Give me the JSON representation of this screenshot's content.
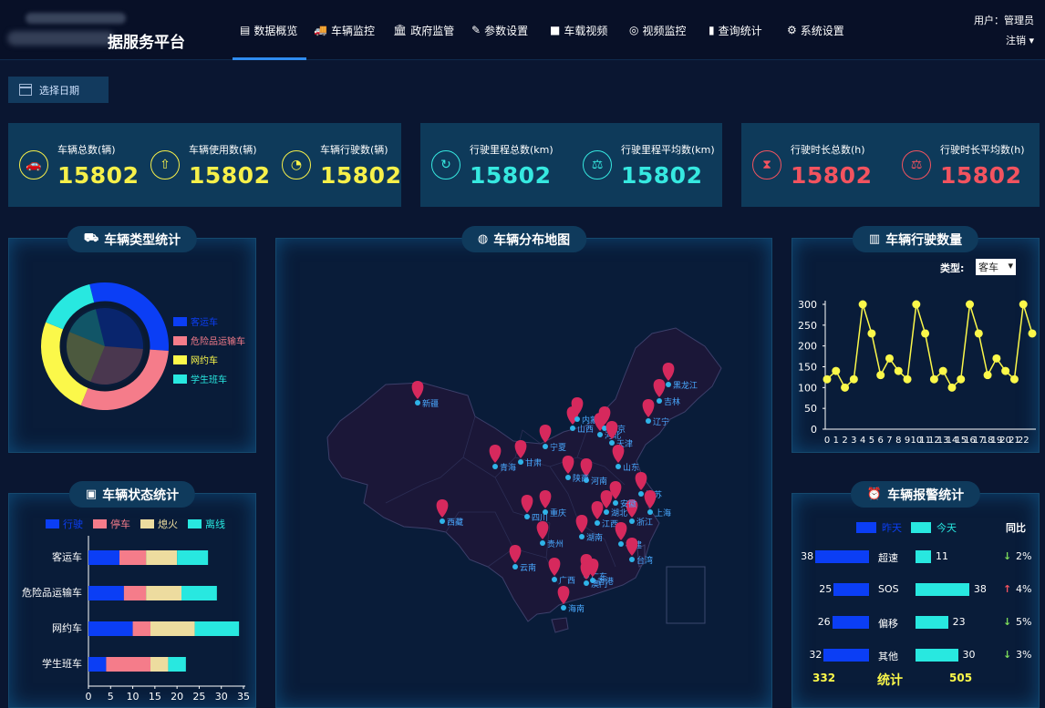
{
  "header": {
    "title": "据服务平台",
    "nav": [
      {
        "icon": "document-icon",
        "glyph": "▤",
        "label": "数据概览",
        "active": true
      },
      {
        "icon": "truck-icon",
        "glyph": "🚚",
        "label": "车辆监控"
      },
      {
        "icon": "bank-icon",
        "glyph": "🏛",
        "label": "政府监管"
      },
      {
        "icon": "edit-icon",
        "glyph": "✎",
        "label": "参数设置"
      },
      {
        "icon": "video-camera-icon",
        "glyph": "■",
        "label": "车载视频"
      },
      {
        "icon": "webcam-icon",
        "glyph": "◎",
        "label": "视频监控"
      },
      {
        "icon": "bar-chart-icon",
        "glyph": "▮",
        "label": "查询统计"
      },
      {
        "icon": "gear-icon",
        "glyph": "⚙",
        "label": "系统设置"
      }
    ],
    "user_label": "用户：管理员",
    "logout_label": "注销"
  },
  "date_picker": {
    "label": "选择日期"
  },
  "stats": [
    {
      "icon": "car-icon",
      "glyph": "🚗",
      "label": "车辆总数(辆)",
      "value": "15802",
      "color": "#f6f04a"
    },
    {
      "icon": "upload-icon",
      "glyph": "⇧",
      "label": "车辆使用数(辆)",
      "value": "15802",
      "color": "#f6f04a"
    },
    {
      "icon": "pie-icon",
      "glyph": "◔",
      "label": "车辆行驶数(辆)",
      "value": "15802",
      "color": "#f6f04a"
    },
    {
      "icon": "speed-icon",
      "glyph": "↻",
      "label": "行驶里程总数(km)",
      "value": "15802",
      "color": "#36e8e0"
    },
    {
      "icon": "scale-icon",
      "glyph": "⚖",
      "label": "行驶里程平均数(km)",
      "value": "15802",
      "color": "#36e8e0"
    },
    {
      "icon": "hourglass-icon",
      "glyph": "⧗",
      "label": "行驶时长总数(h)",
      "value": "15802",
      "color": "#f2535f"
    },
    {
      "icon": "scale-icon",
      "glyph": "⚖",
      "label": "行驶时长平均数(h)",
      "value": "15802",
      "color": "#f2535f"
    }
  ],
  "panels": {
    "vehicle_type": {
      "title": "车辆类型统计"
    },
    "vehicle_map": {
      "title": "车辆分布地图"
    },
    "vehicle_count": {
      "title": "车辆行驶数量",
      "type_label": "类型:",
      "type_value": "客车"
    },
    "vehicle_status": {
      "title": "车辆状态统计"
    },
    "vehicle_alarm": {
      "title": "车辆报警统计"
    }
  },
  "colors": {
    "blue": "#0b3ef5",
    "pink": "#f57c8a",
    "yellow": "#fbf84a",
    "cyan": "#28e8e0",
    "khaki": "#eddc9f"
  },
  "chart_data": [
    {
      "type": "pie",
      "categories": [
        "客运车",
        "危险品运输车",
        "网约车",
        "学生班车"
      ],
      "values": [
        30,
        30,
        25,
        15
      ],
      "legend_position": "right"
    },
    {
      "type": "line",
      "x": [
        0,
        1,
        2,
        3,
        4,
        5,
        6,
        7,
        8,
        9,
        10,
        11,
        12,
        13,
        14,
        15,
        16,
        17,
        18,
        19,
        20,
        21,
        22,
        23
      ],
      "x_ticks": [
        "0",
        "1",
        "2",
        "3",
        "4",
        "5",
        "6",
        "7",
        "8",
        "9",
        "10",
        "11",
        "12",
        "13",
        "14",
        "15",
        "16",
        "17",
        "18",
        "19",
        "20",
        "21",
        "22"
      ],
      "values": [
        120,
        140,
        100,
        120,
        300,
        230,
        130,
        170,
        140,
        120,
        300,
        230,
        120,
        140,
        100,
        120,
        300,
        230,
        130,
        170,
        140,
        120,
        300,
        230
      ],
      "ylim": [
        0,
        300
      ],
      "yticks": [
        0,
        50,
        100,
        150,
        200,
        250,
        300
      ],
      "grid": false
    },
    {
      "type": "bar",
      "orientation": "horizontal",
      "stacked": true,
      "categories": [
        "客运车",
        "危险品运输车",
        "网约车",
        "学生班车"
      ],
      "series": [
        {
          "name": "行驶",
          "values": [
            7,
            8,
            10,
            4
          ]
        },
        {
          "name": "停车",
          "values": [
            6,
            5,
            4,
            10
          ]
        },
        {
          "name": "熄火",
          "values": [
            7,
            8,
            10,
            4
          ]
        },
        {
          "name": "离线",
          "values": [
            7,
            8,
            10,
            4
          ]
        }
      ],
      "xlim": [
        0,
        35
      ],
      "xticks": [
        0,
        5,
        10,
        15,
        20,
        25,
        30,
        35
      ],
      "legend_position": "top"
    },
    {
      "type": "bar",
      "orientation": "horizontal",
      "categories": [
        "超速",
        "SOS",
        "偏移",
        "其他"
      ],
      "series": [
        {
          "name": "昨天",
          "values": [
            38,
            25,
            26,
            32
          ]
        },
        {
          "name": "今天",
          "values": [
            11,
            38,
            23,
            30
          ]
        }
      ],
      "yoy_header": "同比",
      "yoy": [
        {
          "dir": "down",
          "arrow": "↓",
          "value": "2%",
          "color": "#7ddc5a"
        },
        {
          "dir": "up",
          "arrow": "↑",
          "value": "4%",
          "color": "#f2535f"
        },
        {
          "dir": "down",
          "arrow": "↓",
          "value": "5%",
          "color": "#7ddc5a"
        },
        {
          "dir": "down",
          "arrow": "↓",
          "value": "3%",
          "color": "#7ddc5a"
        }
      ],
      "totals": {
        "label": "统计",
        "yesterday": "332",
        "today": "505"
      }
    }
  ],
  "map": {
    "provinces": [
      "新疆",
      "西藏",
      "甘肃",
      "宁夏",
      "青海",
      "四川",
      "云南",
      "贵州",
      "广西",
      "海南",
      "湖南",
      "湖北",
      "河南",
      "陕西",
      "山西",
      "内蒙古",
      "河北",
      "北京",
      "天津",
      "山东",
      "江苏",
      "上海",
      "浙江",
      "安徽",
      "江西",
      "福建",
      "广东",
      "台湾",
      "香港",
      "澳门",
      "重庆",
      "辽宁",
      "吉林",
      "黑龙江"
    ]
  }
}
